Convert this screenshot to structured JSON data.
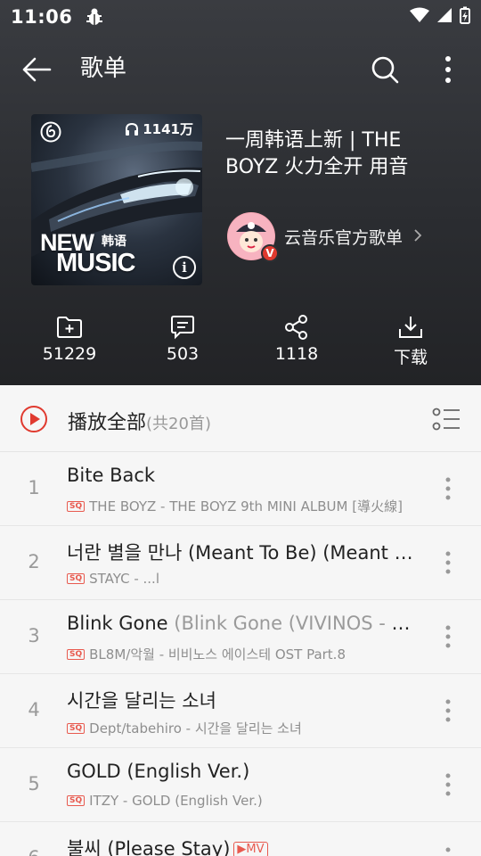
{
  "status_bar": {
    "time": "11:06"
  },
  "app_bar": {
    "title": "歌单"
  },
  "cover": {
    "plays": "1141万",
    "badge_line1": "NEW",
    "badge_korean": "韩语",
    "badge_line2": "MUSIC",
    "info_glyph": "i"
  },
  "playlist": {
    "title": "一周韩语上新 | THE BOYZ 火力全开 用音",
    "creator": "云音乐官方歌单",
    "creator_badge": "V"
  },
  "actions": [
    {
      "icon": "folder-add-icon",
      "label": "51229"
    },
    {
      "icon": "comment-icon",
      "label": "503"
    },
    {
      "icon": "share-icon",
      "label": "1118"
    },
    {
      "icon": "download-icon",
      "label": "下载"
    }
  ],
  "play_all": {
    "label": "播放全部",
    "count": "(共20首)"
  },
  "songs": [
    {
      "index": "1",
      "title": "Bite Back",
      "title_alt": "",
      "quality": "SQ",
      "subtitle": "THE BOYZ - THE BOYZ 9th MINI ALBUM [導火線]"
    },
    {
      "index": "2",
      "title": "너란 별을 만나 (Meant To Be) (Meant To Be)",
      "title_alt": "",
      "quality": "SQ",
      "subtitle": "STAYC - ...l"
    },
    {
      "index": "3",
      "title": "Blink Gone",
      "title_alt": " (Blink Gone (VIVINOS - A...",
      "quality": "SQ",
      "subtitle": "BL8M/악월 - 비비노스   에이스테 OST Part.8"
    },
    {
      "index": "4",
      "title": "시간을 달리는 소녀",
      "title_alt": "",
      "quality": "SQ",
      "subtitle": "Dept/tabehiro - 시간을 달리는 소녀"
    },
    {
      "index": "5",
      "title": "GOLD (English Ver.)",
      "title_alt": "",
      "quality": "SQ",
      "subtitle": "ITZY - GOLD (English Ver.)"
    },
    {
      "index": "6",
      "title": "불씨 (Please Stay)",
      "title_alt": "",
      "quality": "",
      "subtitle": "",
      "tag": "▶MV"
    }
  ],
  "colors": {
    "accent": "#e03a2f",
    "hero_bg": "#2d2f33"
  }
}
